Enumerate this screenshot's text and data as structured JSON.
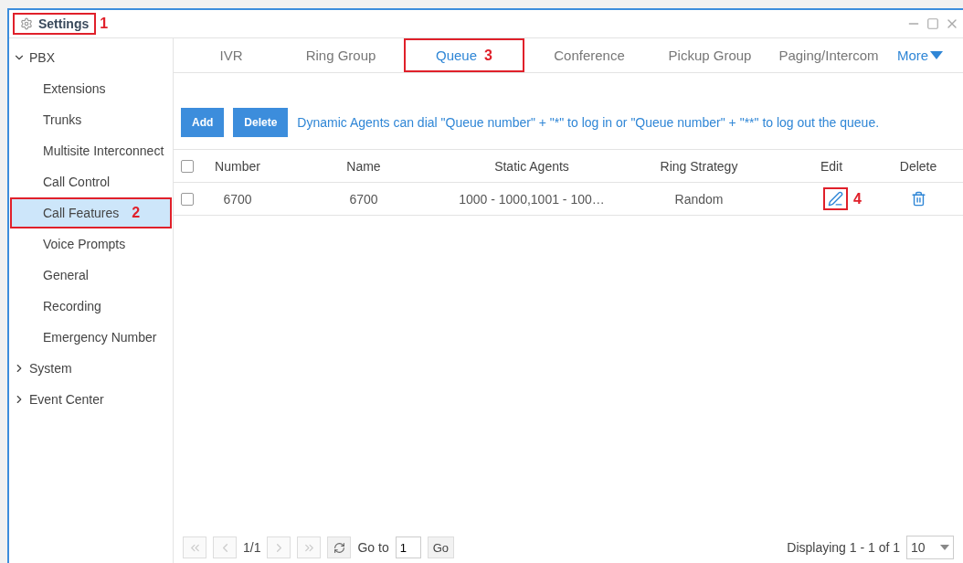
{
  "window": {
    "title": "Settings",
    "marker": "1"
  },
  "sidebar": {
    "items": [
      {
        "label": "PBX",
        "expanded": true,
        "children": [
          {
            "label": "Extensions",
            "selected": false
          },
          {
            "label": "Trunks",
            "selected": false
          },
          {
            "label": "Multisite Interconnect",
            "selected": false
          },
          {
            "label": "Call Control",
            "selected": false
          },
          {
            "label": "Call Features",
            "selected": true,
            "marker": "2"
          },
          {
            "label": "Voice Prompts",
            "selected": false
          },
          {
            "label": "General",
            "selected": false
          },
          {
            "label": "Recording",
            "selected": false
          },
          {
            "label": "Emergency Number",
            "selected": false
          }
        ]
      },
      {
        "label": "System",
        "expanded": false
      },
      {
        "label": "Event Center",
        "expanded": false
      }
    ]
  },
  "tabs": [
    {
      "label": "IVR",
      "selected": false
    },
    {
      "label": "Ring Group",
      "selected": false
    },
    {
      "label": "Queue",
      "selected": true,
      "marker": "3"
    },
    {
      "label": "Conference",
      "selected": false
    },
    {
      "label": "Pickup Group",
      "selected": false
    },
    {
      "label": "Paging/Intercom",
      "selected": false
    }
  ],
  "more": "More",
  "toolbar": {
    "buttons": [
      "Add",
      "Delete"
    ],
    "hint": "Dynamic Agents can dial \"Queue number\" + \"*\" to log in or \"Queue number\" + \"**\" to log out the queue."
  },
  "table": {
    "select_all": {
      "checked": false
    },
    "columns": [
      "Number",
      "Name",
      "Static Agents",
      "Ring Strategy",
      "Edit",
      "Delete"
    ],
    "rows": [
      {
        "checked": false,
        "cells": [
          "6700",
          "6700",
          "1000 - 1000,1001 - 100…",
          "Random"
        ],
        "edit_marker": "4"
      }
    ]
  },
  "pagination": {
    "page": "1/1",
    "goto_label": "Go to",
    "goto_value": "1",
    "go": "Go",
    "summary": "Displaying 1 - 1 of 1",
    "page_size": "10"
  }
}
